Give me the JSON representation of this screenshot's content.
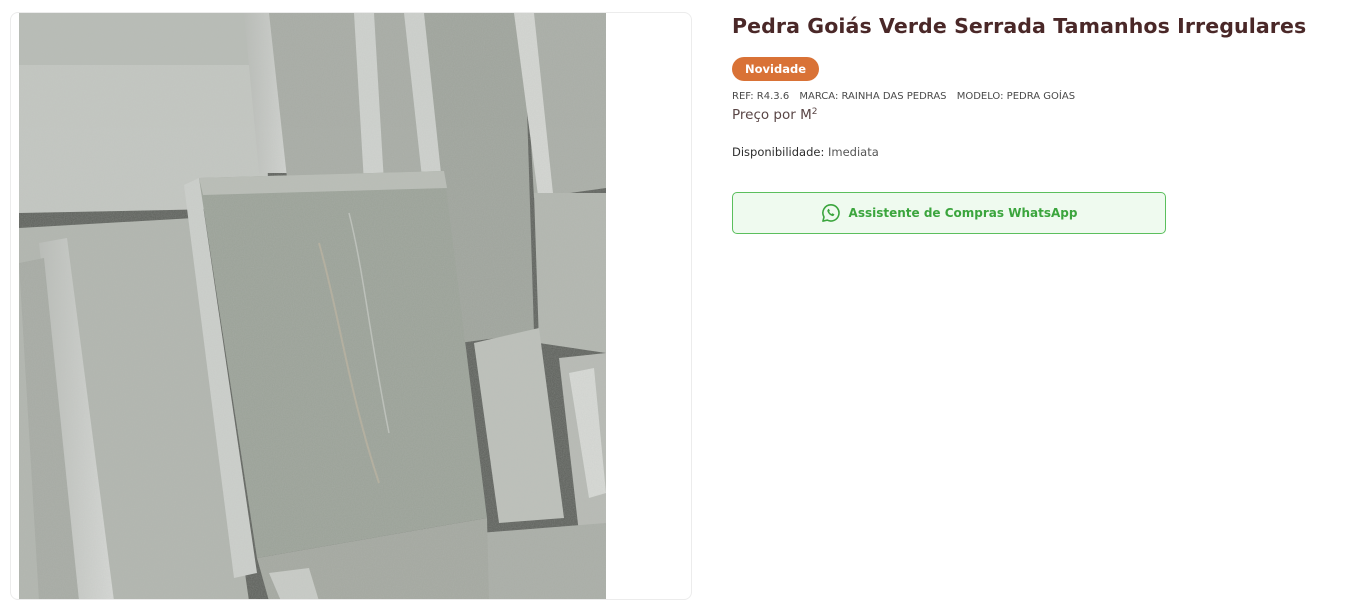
{
  "product": {
    "title": "Pedra Goiás Verde Serrada Tamanhos Irregulares",
    "badge": "Novidade",
    "ref": "REF: R4.3.6",
    "brand": "MARCA: RAINHA DAS PEDRAS",
    "model": "MODELO: PEDRA GOÍAS",
    "price_unit": "Preço por M",
    "price_unit_sup": "2",
    "availability_label": "Disponibilidade:",
    "availability_value": " Imediata"
  },
  "image": {
    "alt": "Pedra Goiás Verde Serrada"
  },
  "whatsapp": {
    "label": "Assistente de Compras WhatsApp",
    "icon": "whatsapp-icon"
  },
  "colors": {
    "title": "#4a2828",
    "badge_bg": "#d97236",
    "whatsapp_green": "#3ba53d",
    "whatsapp_bg": "#effaef"
  }
}
